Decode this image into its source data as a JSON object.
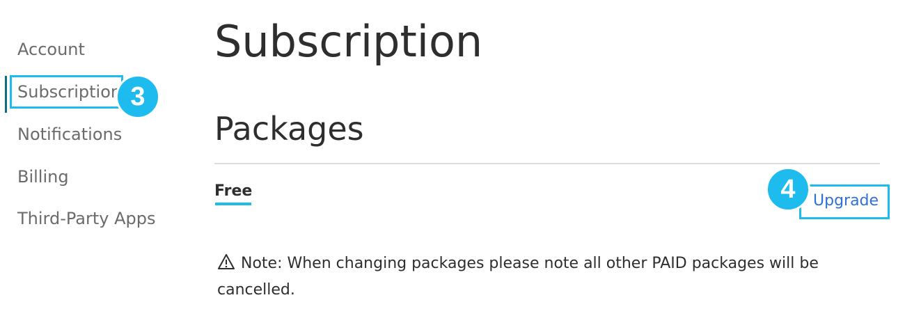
{
  "sidebar": {
    "items": [
      {
        "label": "Account"
      },
      {
        "label": "Subscription"
      },
      {
        "label": "Notifications"
      },
      {
        "label": "Billing"
      },
      {
        "label": "Third-Party Apps"
      }
    ],
    "active_item": "Subscription"
  },
  "annotations": {
    "step_sidebar": "3",
    "step_upgrade": "4",
    "highlight_color": "#1ebbee"
  },
  "main": {
    "title": "Subscription",
    "section_title": "Packages",
    "package": {
      "name": "Free",
      "upgrade_label": "Upgrade"
    },
    "note": {
      "icon": "warning-triangle-icon",
      "text": "Note: When changing packages please note all other PAID packages will be cancelled."
    }
  },
  "colors": {
    "accent": "#1ebbee",
    "link": "#2f6fd6",
    "active_indicator": "#0d6e7e"
  }
}
